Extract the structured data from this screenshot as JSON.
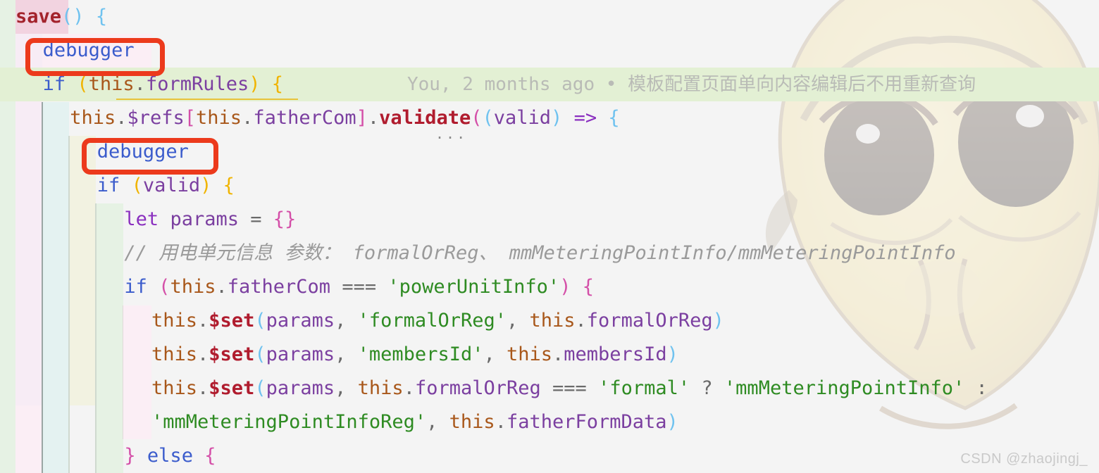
{
  "editor": {
    "background_color": "#f4f4f4",
    "font_size_px": 27,
    "line_height_px": 48,
    "indent_rainbow_colors": [
      "#e6f2e4",
      "#f7ecf5",
      "#e4f2f1",
      "#f2f2e1"
    ],
    "highlight_line_color": "#e3f0d4",
    "annotation_box_color": "#ec3a1c"
  },
  "code_lines": [
    {
      "id": "line-save-signature",
      "indent": 0,
      "tokens": [
        {
          "text": "save",
          "cls": "fn"
        },
        {
          "text": "()",
          "cls": "paren-b"
        },
        {
          "text": " ",
          "cls": "op"
        },
        {
          "text": "{",
          "cls": "paren-b"
        }
      ]
    },
    {
      "id": "line-debugger-1",
      "indent": 1,
      "tokens": [
        {
          "text": "debugger",
          "cls": "kw"
        }
      ]
    },
    {
      "id": "line-if-formrules",
      "indent": 1,
      "tokens": [
        {
          "text": "if",
          "cls": "kw"
        },
        {
          "text": " ",
          "cls": "op"
        },
        {
          "text": "(",
          "cls": "paren-y"
        },
        {
          "text": "this",
          "cls": "this"
        },
        {
          "text": ".",
          "cls": "op"
        },
        {
          "text": "formRules",
          "cls": "prop"
        },
        {
          "text": ")",
          "cls": "paren-y"
        },
        {
          "text": " ",
          "cls": "op"
        },
        {
          "text": "{",
          "cls": "paren-y"
        }
      ]
    },
    {
      "id": "line-refs-validate",
      "indent": 2,
      "tokens": [
        {
          "text": "this",
          "cls": "this"
        },
        {
          "text": ".",
          "cls": "op"
        },
        {
          "text": "$refs",
          "cls": "prop"
        },
        {
          "text": "[",
          "cls": "paren-p"
        },
        {
          "text": "this",
          "cls": "this"
        },
        {
          "text": ".",
          "cls": "op"
        },
        {
          "text": "fatherCom",
          "cls": "prop"
        },
        {
          "text": "]",
          "cls": "paren-p"
        },
        {
          "text": ".",
          "cls": "op"
        },
        {
          "text": "validate",
          "cls": "fnb"
        },
        {
          "text": "(",
          "cls": "paren-p"
        },
        {
          "text": "(",
          "cls": "paren-b"
        },
        {
          "text": "valid",
          "cls": "var"
        },
        {
          "text": ")",
          "cls": "paren-b"
        },
        {
          "text": " ",
          "cls": "op"
        },
        {
          "text": "=>",
          "cls": "kw2"
        },
        {
          "text": " ",
          "cls": "op"
        },
        {
          "text": "{",
          "cls": "paren-b"
        }
      ]
    },
    {
      "id": "line-debugger-2",
      "indent": 3,
      "tokens": [
        {
          "text": "debugger",
          "cls": "kw"
        }
      ]
    },
    {
      "id": "line-if-valid",
      "indent": 3,
      "tokens": [
        {
          "text": "if",
          "cls": "kw"
        },
        {
          "text": " ",
          "cls": "op"
        },
        {
          "text": "(",
          "cls": "paren-y"
        },
        {
          "text": "valid",
          "cls": "var"
        },
        {
          "text": ")",
          "cls": "paren-y"
        },
        {
          "text": " ",
          "cls": "op"
        },
        {
          "text": "{",
          "cls": "paren-y"
        }
      ]
    },
    {
      "id": "line-let-params",
      "indent": 4,
      "tokens": [
        {
          "text": "let",
          "cls": "kw2"
        },
        {
          "text": " ",
          "cls": "op"
        },
        {
          "text": "params",
          "cls": "var"
        },
        {
          "text": " ",
          "cls": "op"
        },
        {
          "text": "=",
          "cls": "op"
        },
        {
          "text": " ",
          "cls": "op"
        },
        {
          "text": "{}",
          "cls": "paren-p"
        }
      ]
    },
    {
      "id": "line-comment",
      "indent": 4,
      "tokens": [
        {
          "text": "// 用电单元信息 参数： formalOrReg、 mmMeteringPointInfo/mmMeteringPointInfo",
          "cls": "cmt"
        }
      ]
    },
    {
      "id": "line-if-powerunitinfo",
      "indent": 4,
      "tokens": [
        {
          "text": "if",
          "cls": "kw"
        },
        {
          "text": " ",
          "cls": "op"
        },
        {
          "text": "(",
          "cls": "paren-p"
        },
        {
          "text": "this",
          "cls": "this"
        },
        {
          "text": ".",
          "cls": "op"
        },
        {
          "text": "fatherCom",
          "cls": "prop"
        },
        {
          "text": " ",
          "cls": "op"
        },
        {
          "text": "===",
          "cls": "op"
        },
        {
          "text": " ",
          "cls": "op"
        },
        {
          "text": "'powerUnitInfo'",
          "cls": "str"
        },
        {
          "text": ")",
          "cls": "paren-p"
        },
        {
          "text": " ",
          "cls": "op"
        },
        {
          "text": "{",
          "cls": "paren-p"
        }
      ]
    },
    {
      "id": "line-set-formalorreg",
      "indent": 5,
      "tokens": [
        {
          "text": "this",
          "cls": "this"
        },
        {
          "text": ".",
          "cls": "op"
        },
        {
          "text": "$set",
          "cls": "fnb"
        },
        {
          "text": "(",
          "cls": "paren-b"
        },
        {
          "text": "params",
          "cls": "var"
        },
        {
          "text": ", ",
          "cls": "op"
        },
        {
          "text": "'formalOrReg'",
          "cls": "str"
        },
        {
          "text": ", ",
          "cls": "op"
        },
        {
          "text": "this",
          "cls": "this"
        },
        {
          "text": ".",
          "cls": "op"
        },
        {
          "text": "formalOrReg",
          "cls": "prop"
        },
        {
          "text": ")",
          "cls": "paren-b"
        }
      ]
    },
    {
      "id": "line-set-membersid",
      "indent": 5,
      "tokens": [
        {
          "text": "this",
          "cls": "this"
        },
        {
          "text": ".",
          "cls": "op"
        },
        {
          "text": "$set",
          "cls": "fnb"
        },
        {
          "text": "(",
          "cls": "paren-b"
        },
        {
          "text": "params",
          "cls": "var"
        },
        {
          "text": ", ",
          "cls": "op"
        },
        {
          "text": "'membersId'",
          "cls": "str"
        },
        {
          "text": ", ",
          "cls": "op"
        },
        {
          "text": "this",
          "cls": "this"
        },
        {
          "text": ".",
          "cls": "op"
        },
        {
          "text": "membersId",
          "cls": "prop"
        },
        {
          "text": ")",
          "cls": "paren-b"
        }
      ]
    },
    {
      "id": "line-set-ternary",
      "indent": 5,
      "tokens": [
        {
          "text": "this",
          "cls": "this"
        },
        {
          "text": ".",
          "cls": "op"
        },
        {
          "text": "$set",
          "cls": "fnb"
        },
        {
          "text": "(",
          "cls": "paren-b"
        },
        {
          "text": "params",
          "cls": "var"
        },
        {
          "text": ", ",
          "cls": "op"
        },
        {
          "text": "this",
          "cls": "this"
        },
        {
          "text": ".",
          "cls": "op"
        },
        {
          "text": "formalOrReg",
          "cls": "prop"
        },
        {
          "text": " ",
          "cls": "op"
        },
        {
          "text": "===",
          "cls": "op"
        },
        {
          "text": " ",
          "cls": "op"
        },
        {
          "text": "'formal'",
          "cls": "str"
        },
        {
          "text": " ",
          "cls": "op"
        },
        {
          "text": "?",
          "cls": "op"
        },
        {
          "text": " ",
          "cls": "op"
        },
        {
          "text": "'mmMeteringPointInfo'",
          "cls": "str"
        },
        {
          "text": " :",
          "cls": "op"
        }
      ]
    },
    {
      "id": "line-ternary-cont",
      "indent": 5,
      "tokens": [
        {
          "text": "'mmMeteringPointInfoReg'",
          "cls": "str"
        },
        {
          "text": ", ",
          "cls": "op"
        },
        {
          "text": "this",
          "cls": "this"
        },
        {
          "text": ".",
          "cls": "op"
        },
        {
          "text": "fatherFormData",
          "cls": "prop"
        },
        {
          "text": ")",
          "cls": "paren-b"
        }
      ]
    },
    {
      "id": "line-else",
      "indent": 4,
      "tokens": [
        {
          "text": "}",
          "cls": "paren-p"
        },
        {
          "text": " ",
          "cls": "op"
        },
        {
          "text": "else",
          "cls": "kw"
        },
        {
          "text": " ",
          "cls": "op"
        },
        {
          "text": "{",
          "cls": "paren-p"
        }
      ]
    }
  ],
  "blame": {
    "author": "You,",
    "age": "2 months ago",
    "separator": "•",
    "message": "模板配置页面单向内容编辑后不用重新查询",
    "full_text": "You, 2 months ago • 模板配置页面单向内容编辑后不用重新查询"
  },
  "annotations": [
    {
      "id": "redbox-debugger-1",
      "label": "debugger"
    },
    {
      "id": "redbox-debugger-2",
      "label": "debugger"
    }
  ],
  "inline_hint": {
    "id": "code-lens-dots",
    "text": "..."
  },
  "watermark": {
    "text": "CSDN @zhaojingj_"
  }
}
